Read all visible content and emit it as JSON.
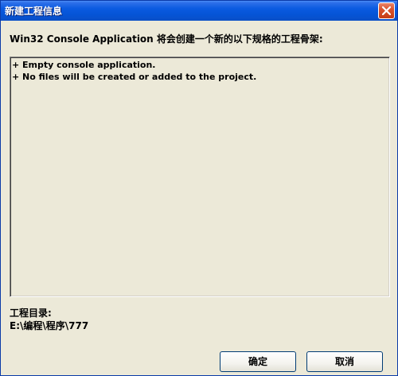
{
  "window": {
    "title": "新建工程信息",
    "close_label": "关闭"
  },
  "header": {
    "text": "Win32 Console Application 将会创建一个新的以下规格的工程骨架:"
  },
  "info_lines": [
    "+ Empty console application.",
    "+ No files will be created or added to the project."
  ],
  "project_dir": {
    "label": "工程目录:",
    "value": "E:\\编程\\程序\\777"
  },
  "buttons": {
    "ok": "确定",
    "cancel": "取消"
  },
  "colors": {
    "titlebar": "#0a5ae0",
    "dialog_face": "#ece9d8",
    "close_button": "#d9532f",
    "button_border": "#003c74"
  },
  "icons": {
    "close": "close-icon"
  }
}
